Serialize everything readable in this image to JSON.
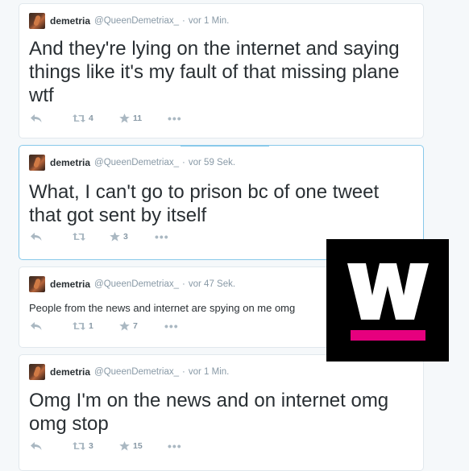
{
  "tweets": [
    {
      "name": "demetria",
      "handle": "@QueenDemetriax_",
      "time": "vor 1 Min.",
      "text": "And they're lying on the internet and saying things like it's my fault of that missing plane wtf",
      "retweets": "4",
      "favorites": "11"
    },
    {
      "name": "demetria",
      "handle": "@QueenDemetriax_",
      "time": "vor 59 Sek.",
      "text": "What, I can't go to prison bc of one tweet that got sent by itself",
      "retweets": "",
      "favorites": "3"
    },
    {
      "name": "demetria",
      "handle": "@QueenDemetriax_",
      "time": "vor 47 Sek.",
      "text": "People from the news and internet are spying on me omg",
      "retweets": "1",
      "favorites": "7"
    },
    {
      "name": "demetria",
      "handle": "@QueenDemetriax_",
      "time": "vor 1 Min.",
      "text": "Omg I'm on the news and on internet omg omg stop",
      "retweets": "3",
      "favorites": "15"
    }
  ],
  "separator": "·",
  "more_label": "•••",
  "logo": {
    "letter": "W",
    "accent": "#e6007e",
    "background": "#000000"
  }
}
